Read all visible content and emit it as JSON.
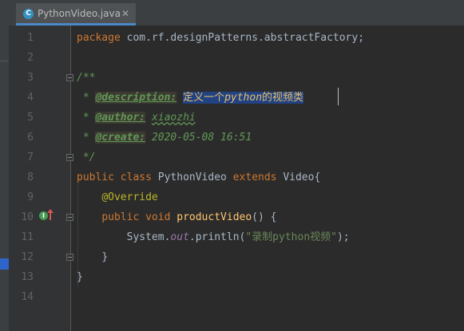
{
  "tab": {
    "icon_letter": "C",
    "filename": "PythonVideo.java",
    "close": "✕"
  },
  "gutter": {
    "line_numbers": [
      "1",
      "2",
      "3",
      "4",
      "5",
      "6",
      "7",
      "8",
      "9",
      "10",
      "11",
      "12",
      "13",
      "14"
    ],
    "override_icon_letter": "I"
  },
  "code": {
    "l1_kw": "package",
    "l1_pkg": " com.rf.designPatterns.abstractFactory;",
    "l3": "/**",
    "l4_star": " * ",
    "l4_tag": "@description:",
    "l4_sel_a": "定义一个",
    "l4_sel_b": "python",
    "l4_sel_c": "的视频类",
    "l5_star": " * ",
    "l5_tag": "@author:",
    "l5_val": "xiaozhi",
    "l6_star": " * ",
    "l6_tag": "@create:",
    "l6_val": "2020-05-08 16:51",
    "l7": " */",
    "l8_kw1": "public",
    "l8_kw2": "class",
    "l8_name": "PythonVideo",
    "l8_kw3": "extends",
    "l8_parent": "Video{",
    "l9_ann": "@Override",
    "l10_kw1": "public",
    "l10_kw2": "void",
    "l10_fn": "productVideo",
    "l10_rest": "() {",
    "l11_a": "System.",
    "l11_out": "out",
    "l11_b": ".println(",
    "l11_str": "\"录制python视频\"",
    "l11_c": ");",
    "l12": "}",
    "l13": "}"
  },
  "colors": {
    "background": "#2b2b2b",
    "keyword": "#cc7832",
    "doc": "#629755",
    "selection": "#214283",
    "annotation": "#bbb529",
    "method": "#ffc66d",
    "string": "#6a8759"
  }
}
